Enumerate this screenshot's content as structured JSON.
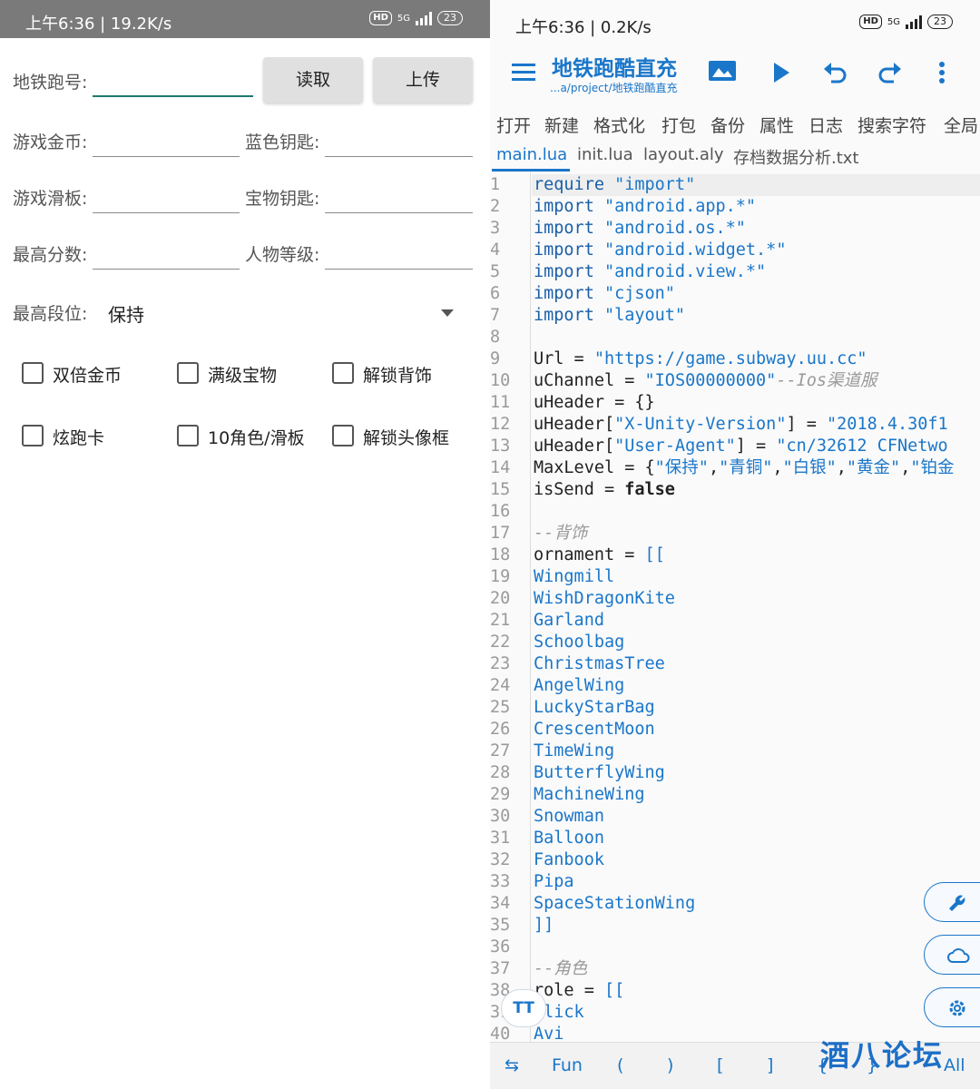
{
  "left": {
    "status": {
      "time": "上午6:36 | 19.2K/s",
      "hd": "HD",
      "net": "5G",
      "battery": "23"
    },
    "fields": {
      "subway_id_label": "地铁跑号:",
      "read_button": "读取",
      "upload_button": "上传",
      "coins_label": "游戏金币:",
      "blue_keys_label": "蓝色钥匙:",
      "boards_label": "游戏滑板:",
      "treasure_keys_label": "宝物钥匙:",
      "high_score_label": "最高分数:",
      "char_level_label": "人物等级:",
      "rank_label": "最高段位:",
      "rank_value": "保持"
    },
    "checkboxes": [
      "双倍金币",
      "满级宝物",
      "解锁背饰",
      "炫跑卡",
      "10角色/滑板",
      "解锁头像框"
    ]
  },
  "right": {
    "status": {
      "time": "上午6:36 | 0.2K/s",
      "hd": "HD",
      "net": "5G",
      "battery": "23"
    },
    "app_title": "地铁跑酷直充",
    "app_path": "...a/project/地铁跑酷直充",
    "menu": [
      "打开",
      "新建",
      "格式化",
      "打包",
      "备份",
      "属性",
      "日志",
      "搜索字符",
      "全局"
    ],
    "tabs": [
      "main.lua",
      "init.lua",
      "layout.aly",
      "存档数据分析.txt"
    ],
    "bottom_bar": [
      "Fun",
      "(",
      ")",
      "[",
      "]",
      "{",
      "}",
      "All"
    ],
    "font_button": "TT",
    "watermark": "酒八论坛",
    "accent": "#1a76c9",
    "code_lines": [
      {
        "n": "1",
        "seg": [
          [
            "k",
            "require "
          ],
          [
            "s",
            "\"import\""
          ]
        ]
      },
      {
        "n": "2",
        "seg": [
          [
            "k",
            "import "
          ],
          [
            "s",
            "\"android.app.*\""
          ]
        ]
      },
      {
        "n": "3",
        "seg": [
          [
            "k",
            "import "
          ],
          [
            "s",
            "\"android.os.*\""
          ]
        ]
      },
      {
        "n": "4",
        "seg": [
          [
            "k",
            "import "
          ],
          [
            "s",
            "\"android.widget.*\""
          ]
        ]
      },
      {
        "n": "5",
        "seg": [
          [
            "k",
            "import "
          ],
          [
            "s",
            "\"android.view.*\""
          ]
        ]
      },
      {
        "n": "6",
        "seg": [
          [
            "k",
            "import "
          ],
          [
            "s",
            "\"cjson\""
          ]
        ]
      },
      {
        "n": "7",
        "seg": [
          [
            "k",
            "import "
          ],
          [
            "s",
            "\"layout\""
          ]
        ]
      },
      {
        "n": "8",
        "seg": []
      },
      {
        "n": "9",
        "seg": [
          [
            "d",
            "Url = "
          ],
          [
            "s",
            "\"https://game.subway.uu.cc\""
          ]
        ]
      },
      {
        "n": "10",
        "seg": [
          [
            "d",
            "uChannel = "
          ],
          [
            "s",
            "\"IOS00000000\""
          ],
          [
            "c",
            "--Ios渠道服"
          ]
        ]
      },
      {
        "n": "11",
        "seg": [
          [
            "d",
            "uHeader = {}"
          ]
        ]
      },
      {
        "n": "12",
        "seg": [
          [
            "d",
            "uHeader["
          ],
          [
            "s",
            "\"X-Unity-Version\""
          ],
          [
            "d",
            "] = "
          ],
          [
            "s",
            "\"2018.4.30f1"
          ]
        ]
      },
      {
        "n": "13",
        "seg": [
          [
            "d",
            "uHeader["
          ],
          [
            "s",
            "\"User-Agent\""
          ],
          [
            "d",
            "] = "
          ],
          [
            "s",
            "\"cn/32612 CFNetwo"
          ]
        ]
      },
      {
        "n": "14",
        "seg": [
          [
            "d",
            "MaxLevel = {"
          ],
          [
            "s",
            "\"保持\""
          ],
          [
            "d",
            ","
          ],
          [
            "s",
            "\"青铜\""
          ],
          [
            "d",
            ","
          ],
          [
            "s",
            "\"白银\""
          ],
          [
            "d",
            ","
          ],
          [
            "s",
            "\"黄金\""
          ],
          [
            "d",
            ","
          ],
          [
            "s",
            "\"铂金"
          ]
        ]
      },
      {
        "n": "15",
        "seg": [
          [
            "d",
            "isSend = "
          ],
          [
            "b",
            "false"
          ]
        ]
      },
      {
        "n": "16",
        "seg": []
      },
      {
        "n": "17",
        "seg": [
          [
            "c",
            "--背饰"
          ]
        ]
      },
      {
        "n": "18",
        "seg": [
          [
            "d",
            "ornament = "
          ],
          [
            "s",
            "[["
          ]
        ]
      },
      {
        "n": "19",
        "seg": [
          [
            "s",
            "Wingmill"
          ]
        ]
      },
      {
        "n": "20",
        "seg": [
          [
            "s",
            "WishDragonKite"
          ]
        ]
      },
      {
        "n": "21",
        "seg": [
          [
            "s",
            "Garland"
          ]
        ]
      },
      {
        "n": "22",
        "seg": [
          [
            "s",
            "Schoolbag"
          ]
        ]
      },
      {
        "n": "23",
        "seg": [
          [
            "s",
            "ChristmasTree"
          ]
        ]
      },
      {
        "n": "24",
        "seg": [
          [
            "s",
            "AngelWing"
          ]
        ]
      },
      {
        "n": "25",
        "seg": [
          [
            "s",
            "LuckyStarBag"
          ]
        ]
      },
      {
        "n": "26",
        "seg": [
          [
            "s",
            "CrescentMoon"
          ]
        ]
      },
      {
        "n": "27",
        "seg": [
          [
            "s",
            "TimeWing"
          ]
        ]
      },
      {
        "n": "28",
        "seg": [
          [
            "s",
            "ButterflyWing"
          ]
        ]
      },
      {
        "n": "29",
        "seg": [
          [
            "s",
            "MachineWing"
          ]
        ]
      },
      {
        "n": "30",
        "seg": [
          [
            "s",
            "Snowman"
          ]
        ]
      },
      {
        "n": "31",
        "seg": [
          [
            "s",
            "Balloon"
          ]
        ]
      },
      {
        "n": "32",
        "seg": [
          [
            "s",
            "Fanbook"
          ]
        ]
      },
      {
        "n": "33",
        "seg": [
          [
            "s",
            "Pipa"
          ]
        ]
      },
      {
        "n": "34",
        "seg": [
          [
            "s",
            "SpaceStationWing"
          ]
        ]
      },
      {
        "n": "35",
        "seg": [
          [
            "s",
            "]]"
          ]
        ]
      },
      {
        "n": "36",
        "seg": []
      },
      {
        "n": "37",
        "seg": [
          [
            "c",
            "--角色"
          ]
        ]
      },
      {
        "n": "38",
        "seg": [
          [
            "d",
            "role = "
          ],
          [
            "s",
            "[["
          ]
        ]
      },
      {
        "n": "39",
        "seg": [
          [
            "s",
            "Jlick"
          ]
        ]
      },
      {
        "n": "40",
        "seg": [
          [
            "s",
            "Avi"
          ]
        ]
      }
    ]
  }
}
